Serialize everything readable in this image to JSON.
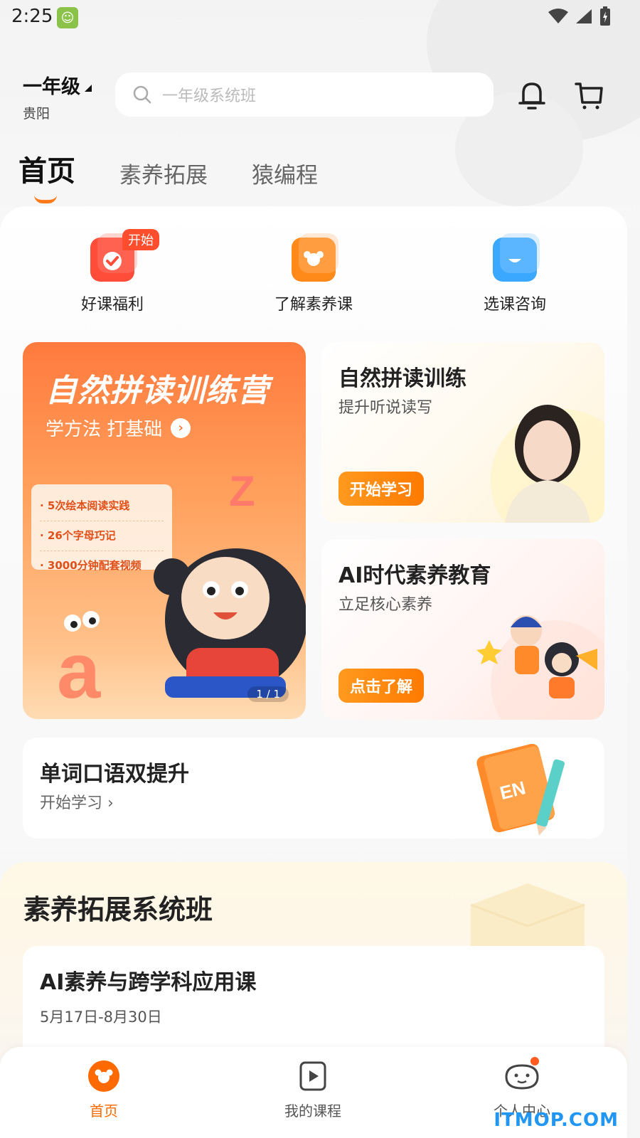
{
  "status_bar": {
    "time": "2:25"
  },
  "header": {
    "grade": "一年级",
    "city": "贵阳",
    "search_placeholder": "一年级系统班"
  },
  "tabs": [
    {
      "label": "首页",
      "active": true
    },
    {
      "label": "素养拓展",
      "active": false
    },
    {
      "label": "猿编程",
      "active": false
    }
  ],
  "quick_actions": [
    {
      "label": "好课福利",
      "icon": "gift-check-icon",
      "badge": "开始",
      "color": "#ff4d3a"
    },
    {
      "label": "了解素养课",
      "icon": "monkey-icon",
      "color": "#ff8a1a"
    },
    {
      "label": "选课咨询",
      "icon": "chat-bubble-icon",
      "color": "#3aa8ff"
    }
  ],
  "banner": {
    "title": "自然拼读训练营",
    "subtitle": "学方法 打基础",
    "points": [
      "5次绘本阅读实践",
      "26个字母巧记",
      "3000分钟配套视频"
    ],
    "pager": "1 / 1"
  },
  "cards": [
    {
      "title": "自然拼读训练",
      "subtitle": "提升听说读写",
      "button": "开始学习"
    },
    {
      "title": "AI时代素养教育",
      "subtitle": "立足核心素养",
      "button": "点击了解"
    }
  ],
  "word_card": {
    "title": "单词口语双提升",
    "subtitle": "开始学习 ›",
    "book_label": "EN"
  },
  "system_section": {
    "title": "素养拓展系统班",
    "course": {
      "title": "AI素养与跨学科应用课",
      "date": "5月17日-8月30日"
    }
  },
  "bottom_nav": [
    {
      "label": "首页",
      "active": true
    },
    {
      "label": "我的课程",
      "active": false
    },
    {
      "label": "个人中心",
      "active": false
    }
  ],
  "watermark": "ITMOP.COM",
  "colors": {
    "accent": "#ff7a1a",
    "accent_dark": "#ff6a00"
  }
}
